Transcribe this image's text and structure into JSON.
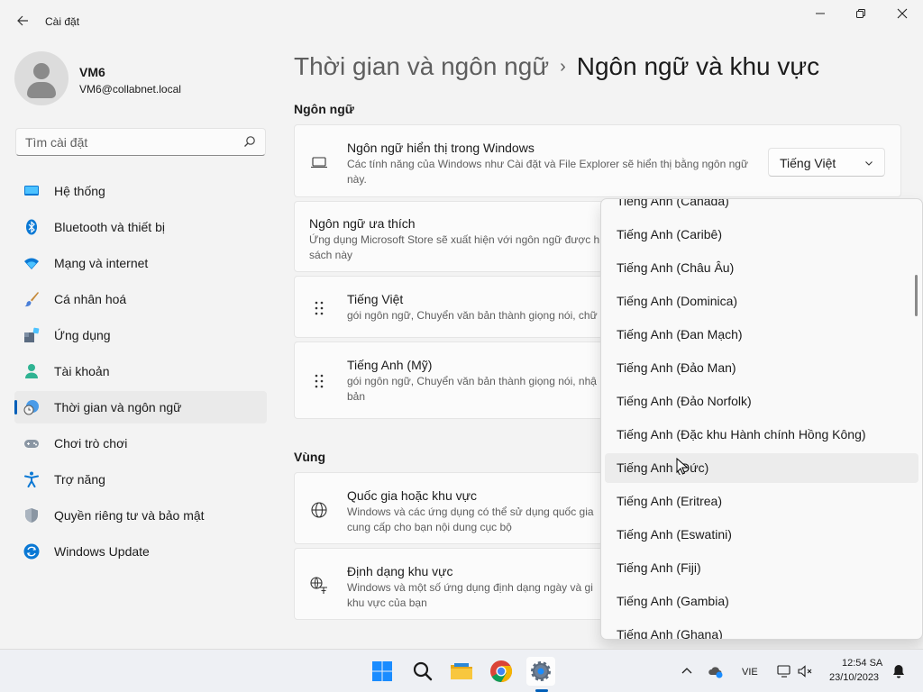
{
  "window": {
    "app_title": "Cài đặt",
    "controls": {
      "minimize": "—",
      "maximize": "❐",
      "close": "✕"
    }
  },
  "profile": {
    "name": "VM6",
    "email": "VM6@collabnet.local"
  },
  "search": {
    "placeholder": "Tìm cài đặt"
  },
  "sidebar": {
    "items": [
      {
        "label": "Hệ thống",
        "icon": "monitor-icon"
      },
      {
        "label": "Bluetooth và thiết bị",
        "icon": "bluetooth-icon"
      },
      {
        "label": "Mạng và internet",
        "icon": "wifi-icon"
      },
      {
        "label": "Cá nhân hoá",
        "icon": "brush-icon"
      },
      {
        "label": "Ứng dụng",
        "icon": "apps-icon"
      },
      {
        "label": "Tài khoản",
        "icon": "account-icon"
      },
      {
        "label": "Thời gian và ngôn ngữ",
        "icon": "time-language-icon",
        "active": true
      },
      {
        "label": "Chơi trò chơi",
        "icon": "gamepad-icon"
      },
      {
        "label": "Trợ năng",
        "icon": "accessibility-icon"
      },
      {
        "label": "Quyền riêng tư và bảo mật",
        "icon": "shield-icon"
      },
      {
        "label": "Windows Update",
        "icon": "update-icon"
      }
    ]
  },
  "breadcrumb": {
    "parent": "Thời gian và ngôn ngữ",
    "separator": "›",
    "current": "Ngôn ngữ và khu vực"
  },
  "language_section": {
    "title": "Ngôn ngữ",
    "display_language": {
      "title": "Ngôn ngữ hiển thị trong Windows",
      "description": "Các tính năng của Windows như Cài đặt và File Explorer sẽ hiển thị bằng ngôn ngữ này.",
      "selected": "Tiếng Việt"
    },
    "preferred": {
      "title": "Ngôn ngữ ưa thích",
      "description": "Ứng dụng Microsoft Store sẽ xuất hiện với ngôn ngữ được h sách này"
    },
    "installed": [
      {
        "title": "Tiếng Việt",
        "description": "gói ngôn ngữ, Chuyển văn bản thành giọng nói, chữ"
      },
      {
        "title": "Tiếng Anh (Mỹ)",
        "description": "gói ngôn ngữ, Chuyển văn bản thành giọng nói, nhậ bản"
      }
    ]
  },
  "region_section": {
    "title": "Vùng",
    "country": {
      "title": "Quốc gia hoặc khu vực",
      "description": "Windows và các ứng dụng có thể sử dụng quốc gia cung cấp cho bạn nội dung cục bộ"
    },
    "format": {
      "title": "Định dạng khu vực",
      "description": "Windows và một số ứng dụng định dạng ngày và gi khu vực của bạn"
    }
  },
  "dropdown_list": {
    "items": [
      "Tiếng Anh (Canada)",
      "Tiếng Anh (Caribê)",
      "Tiếng Anh (Châu Âu)",
      "Tiếng Anh (Dominica)",
      "Tiếng Anh (Đan Mạch)",
      "Tiếng Anh (Đảo Man)",
      "Tiếng Anh (Đảo Norfolk)",
      "Tiếng Anh (Đặc khu Hành chính Hồng Kông)",
      "Tiếng Anh (Đức)",
      "Tiếng Anh (Eritrea)",
      "Tiếng Anh (Eswatini)",
      "Tiếng Anh (Fiji)",
      "Tiếng Anh (Gambia)",
      "Tiếng Anh (Ghana)"
    ],
    "hovered_index": 8
  },
  "taskbar": {
    "apps": [
      "start-icon",
      "search-icon",
      "file-explorer-icon",
      "chrome-icon",
      "settings-icon"
    ],
    "active_app": "settings-icon",
    "language": "VIE",
    "time": "12:54 SA",
    "date": "23/10/2023"
  },
  "colors": {
    "accent": "#005fb8",
    "background": "#f3f3f3",
    "card": "#fbfbfb"
  }
}
